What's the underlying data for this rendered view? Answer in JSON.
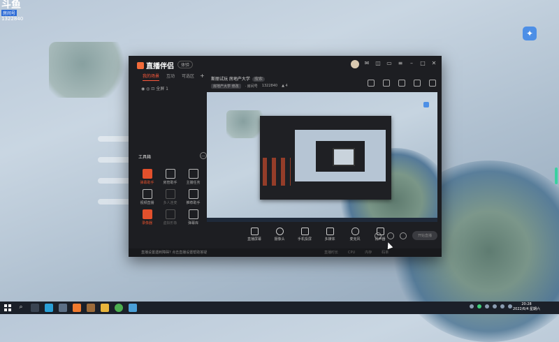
{
  "desktop": {
    "brand_logo": "斗鱼",
    "brand_sub": "房间号",
    "room_number": "1322840"
  },
  "app": {
    "name": "直播伴侣",
    "version_badge": "体验",
    "tabs": [
      "我的场景",
      "互动",
      "可选区"
    ],
    "scene_item": "全屏 1",
    "room_title": "斯丽试玩 房地产大学",
    "room_tag": "搜索",
    "info": {
      "category": "房地产大学",
      "category_action": "修改",
      "room_label": "· 房间号",
      "room_id": "1322840",
      "fans": "4"
    },
    "tools_title": "工具箱",
    "tools": [
      {
        "label": "弹幕助手",
        "hot": true
      },
      {
        "label": "房管助手",
        "hot": false
      },
      {
        "label": "主播任务",
        "hot": false
      },
      {
        "label": "视频直播",
        "hot": false
      },
      {
        "label": "多人连麦",
        "hot": false,
        "dim": true
      },
      {
        "label": "推荐助手",
        "hot": false
      },
      {
        "label": "录像器",
        "hot": true
      },
      {
        "label": "虚拟形象",
        "hot": false,
        "dim": true
      },
      {
        "label": "弹幕库",
        "hot": false
      }
    ],
    "controls": [
      {
        "label": "直播屏幕",
        "icon": "screen-icon"
      },
      {
        "label": "摄像头",
        "icon": "camera-icon"
      },
      {
        "label": "手机投屏",
        "icon": "phone-cast-icon"
      },
      {
        "label": "多媒体",
        "icon": "media-icon"
      },
      {
        "label": "麦克风",
        "icon": "microphone-icon"
      },
      {
        "label": "扬声器",
        "icon": "speaker-icon"
      }
    ],
    "go_live_label": "开始直播",
    "footer_left": "直播设置遇到障碍? 点击直播设置帮助答疑",
    "footer_stats": [
      "直播时长",
      "CPU",
      "内存",
      "码率"
    ]
  },
  "taskbar": {
    "time": "20:28",
    "date": "2022/6/4 星期六"
  },
  "colors": {
    "accent": "#e3502c",
    "window_bg": "#1d1e22",
    "taskbar": "#1b2029"
  }
}
